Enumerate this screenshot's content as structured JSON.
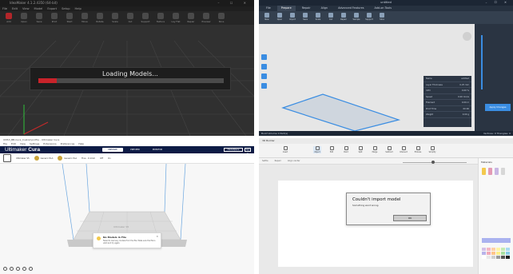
{
  "q1": {
    "title": "IdeaMaker 4.1.2.4350 (64-bit)",
    "window_buttons": "– ☐ ✕",
    "menu": [
      "File",
      "Edit",
      "View",
      "Model",
      "Export",
      "Setup",
      "Help"
    ],
    "toolbar": [
      "Add",
      "Open",
      "Save",
      "Print",
      "Start",
      "Move",
      "Rotate",
      "Scale",
      "Cut",
      "Support",
      "Texture",
      "Lay Flat",
      "Repair",
      "Preview",
      "Slice"
    ],
    "loading_text": "Loading Models...",
    "progress": 0.1,
    "accent": "#c8232a"
  },
  "q2": {
    "title": "untitled",
    "window_buttons": "– ☐ ✕",
    "tabs": [
      "File",
      "Prepare",
      "Repair",
      "Align",
      "Advanced Features",
      "Add-on Tools"
    ],
    "active_tab": "Prepare",
    "ribbon": [
      "New",
      "Open",
      "Import",
      "Save",
      "Scale",
      "Cut",
      "Repair",
      "Sample",
      "Support",
      "Slice"
    ],
    "info_rows": [
      [
        "Name",
        "untitled"
      ],
      [
        "Layer Thickness",
        "0.25 mm"
      ],
      [
        "Infill",
        "0.00 %"
      ],
      [
        "Speed",
        "0.00 mm/s"
      ],
      [
        "Filament",
        "0.00 m"
      ],
      [
        "Print Time",
        "00:00"
      ],
      [
        "Weight",
        "0.00 g"
      ]
    ],
    "status_left": "Build Volume 0 Part(s)",
    "status_right": "Vertices: 0  Triangles: 0",
    "apply_button": "Apply Changes",
    "accent": "#3a8de2"
  },
  "q3": {
    "title": "UMS3_BB-Cura_Customprofile - Ultimaker Cura",
    "menu": [
      "File",
      "Edit",
      "View",
      "Settings",
      "Extensions",
      "Preferences",
      "Help"
    ],
    "logo_light": "Ultimaker",
    "logo_bold": "Cura",
    "stages": [
      "PREPARE",
      "PREVIEW",
      "MONITOR"
    ],
    "active_stage": "PREPARE",
    "marketplace": "Marketplace",
    "signin": "Sign in",
    "printer": "Ultimaker S5",
    "material1": "Generic PLA",
    "material2": "Generic PLA",
    "profile": "Fine - 0.1mm",
    "support": "Off",
    "adhesion": "On",
    "toast_title": "No Models in File",
    "toast_body": "Failed to load any models from the file. Make sure the file is valid and try again.",
    "toast_close": "✕",
    "plate_label": "Ultimaker S5",
    "header_color": "#0d1b45"
  },
  "q4": {
    "title": "3D Builder",
    "ribbon": [
      "Insert",
      "Object",
      "Edit",
      "Paint",
      "Split",
      "Merge",
      "Subtract",
      "Intersect",
      "Emboss",
      "Simplify"
    ],
    "sub_tools": [
      "Settle",
      "Repair",
      "Align center"
    ],
    "dialog_title": "Couldn't import model",
    "dialog_message": "Something went wrong.",
    "ok_label": "OK",
    "side_header": "Materials",
    "swatches": [
      "#d4c0e8",
      "#f3b6c5",
      "#ffd1a6",
      "#fff3a6",
      "#c6ebb4",
      "#a9dcf2",
      "#b9b4ea",
      "#f1a9b8",
      "#ffc58a",
      "#fff08a",
      "#a8e0a0",
      "#89cde8",
      "#ffffff",
      "#e8e8e8",
      "#cfcfcf",
      "#9a9a9a",
      "#555555",
      "#222222"
    ]
  }
}
